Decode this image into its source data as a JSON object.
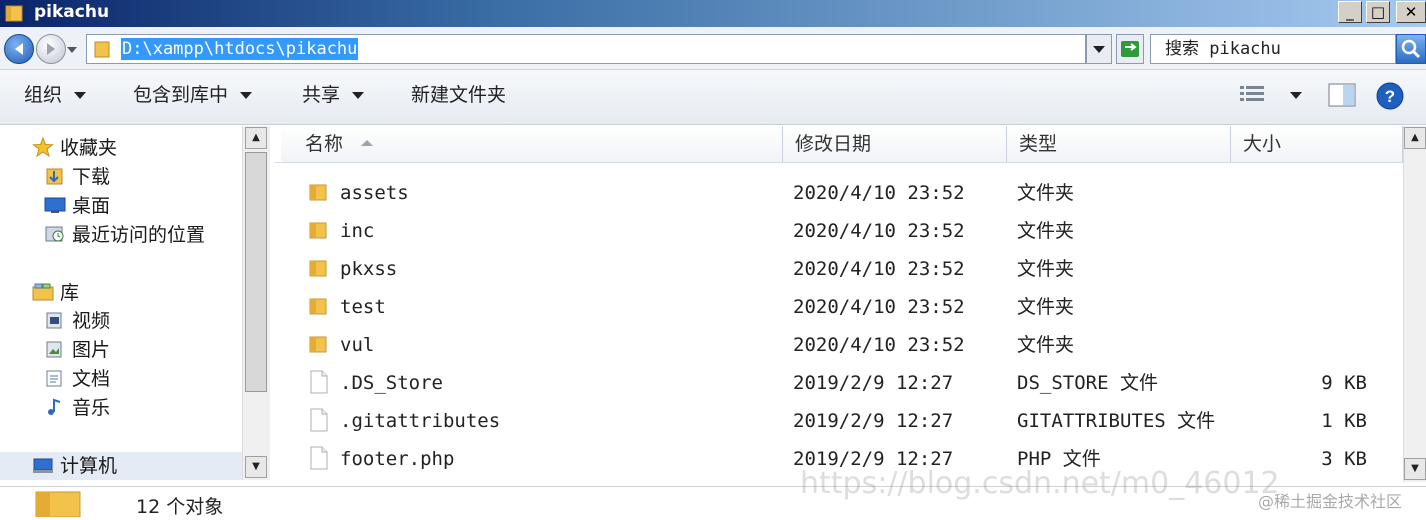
{
  "window": {
    "title": "pikachu"
  },
  "address": {
    "path": "D:\\xampp\\htdocs\\pikachu"
  },
  "search": {
    "placeholder": "搜索 pikachu"
  },
  "toolbar": {
    "organize": "组织",
    "include_in_library": "包含到库中",
    "share": "共享",
    "new_folder": "新建文件夹"
  },
  "nav": {
    "favorites": "收藏夹",
    "downloads": "下载",
    "desktop": "桌面",
    "recent": "最近访问的位置",
    "libraries": "库",
    "videos": "视频",
    "pictures": "图片",
    "documents": "文档",
    "music": "音乐",
    "computer": "计算机"
  },
  "columns": {
    "name": "名称",
    "modified": "修改日期",
    "type": "类型",
    "size": "大小"
  },
  "files": [
    {
      "name": "assets",
      "date": "2020/4/10 23:52",
      "type": "文件夹",
      "size": "",
      "kind": "folder"
    },
    {
      "name": "inc",
      "date": "2020/4/10 23:52",
      "type": "文件夹",
      "size": "",
      "kind": "folder"
    },
    {
      "name": "pkxss",
      "date": "2020/4/10 23:52",
      "type": "文件夹",
      "size": "",
      "kind": "folder"
    },
    {
      "name": "test",
      "date": "2020/4/10 23:52",
      "type": "文件夹",
      "size": "",
      "kind": "folder"
    },
    {
      "name": "vul",
      "date": "2020/4/10 23:52",
      "type": "文件夹",
      "size": "",
      "kind": "folder"
    },
    {
      "name": ".DS_Store",
      "date": "2019/2/9 12:27",
      "type": "DS_STORE 文件",
      "size": "9 KB",
      "kind": "file"
    },
    {
      "name": ".gitattributes",
      "date": "2019/2/9 12:27",
      "type": "GITATTRIBUTES 文件",
      "size": "1 KB",
      "kind": "file"
    },
    {
      "name": "footer.php",
      "date": "2019/2/9 12:27",
      "type": "PHP 文件",
      "size": "3 KB",
      "kind": "file"
    }
  ],
  "status": {
    "count": "12 个对象"
  },
  "watermark": {
    "url": "https://blog.csdn.net/m0_46012",
    "site": "@稀土掘金技术社区"
  },
  "colors": {
    "selection": "#3399ff",
    "folder": "#f3c24a",
    "titlebar": "#0a246a"
  }
}
